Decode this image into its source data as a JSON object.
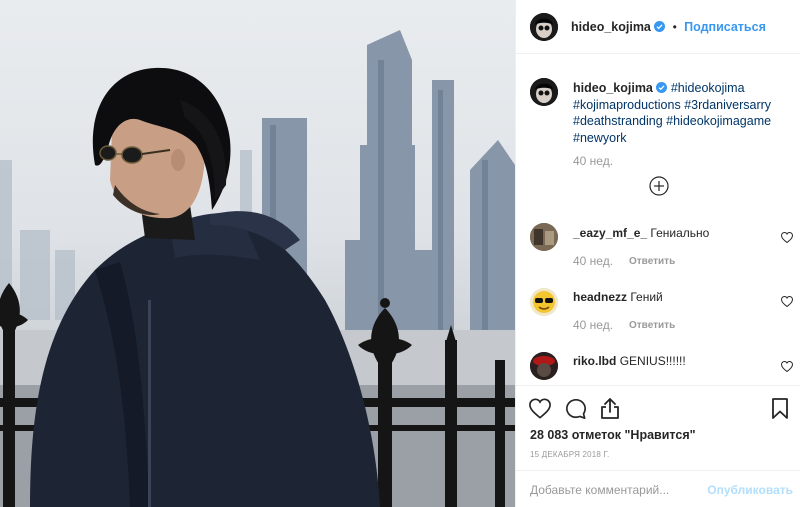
{
  "post": {
    "author": "hideo_kojima",
    "follow_label": "Подписаться",
    "caption": {
      "author": "hideo_kojima",
      "hashtags": [
        "#hideokojima",
        "#kojimaproductions",
        "#3rdaniversarry",
        "#deathstranding",
        "#hideokojimagame",
        "#newyork"
      ],
      "time": "40 нед."
    },
    "comments": [
      {
        "user": "_eazy_mf_e_",
        "text": "Гениально",
        "time": "40 нед.",
        "reply_label": "Ответить"
      },
      {
        "user": "headnezz",
        "text": "Гений",
        "time": "40 нед.",
        "reply_label": "Ответить"
      },
      {
        "user": "riko.lbd",
        "text": "GENIUS!!!!!!",
        "time": "",
        "reply_label": ""
      }
    ],
    "likes": "28 083 отметок \"Нравится\"",
    "date": "15 ДЕКАБРЯ 2018 Г.",
    "add_comment_placeholder": "Добавьте комментарий...",
    "publish_label": "Опубликовать"
  },
  "colors": {
    "link": "#003569",
    "accent": "#3897f0",
    "muted": "#999999",
    "publish_disabled": "#b2dffc"
  }
}
